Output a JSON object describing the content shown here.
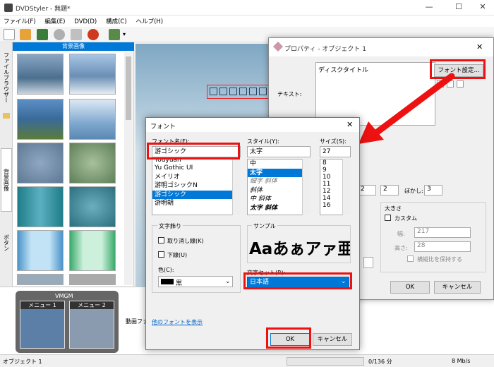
{
  "app": {
    "title": "DVDStyler - 無題*"
  },
  "menu": [
    "ファイル(F)",
    "編集(E)",
    "DVD(D)",
    "構成(C)",
    "ヘルプ(H)"
  ],
  "sidebar": {
    "tabs": [
      "ファイルブラウザー",
      "背景画像",
      "ボタン"
    ],
    "header": "背景画像"
  },
  "bottom": {
    "vmgm_label": "VMGM",
    "menu1": "メニュー 1",
    "menu2": "メニュー 2",
    "movie_label": "動画ファ"
  },
  "status": {
    "left": "オブジェクト 1",
    "progress": "0/136 分",
    "rate": "8 Mb/s"
  },
  "prop_dialog": {
    "title": "プロパティ - オブジェクト 1",
    "text_label": "テキスト:",
    "text_value": "ディスクタイトル",
    "font_button": "フォント設定...",
    "spin1": "2",
    "spin2": "2",
    "blur_label": "ぼかし:",
    "blur_value": "3",
    "size_group": "大きさ",
    "custom_label": "カスタム",
    "width_label": "幅:",
    "width_value": "217",
    "height_label": "高さ:",
    "height_value": "28",
    "keep_ratio": "横縦比を保持する",
    "ok": "OK",
    "cancel": "キャンセル"
  },
  "font_dialog": {
    "title": "フォント",
    "name_label": "フォント名(F):",
    "name_value": "游ゴシック",
    "fonts": [
      "Yu Gothic UI",
      "メイリオ",
      "游明ゴシックN",
      "游ゴシック",
      "游明朝"
    ],
    "fonts_top_partial": "Youyuan",
    "style_label": "スタイル(Y):",
    "style_value": "太字",
    "styles": [
      "中",
      "太字",
      "細字 斜体",
      "斜体",
      "中 斜体",
      "太字 斜体"
    ],
    "size_label": "サイズ(S):",
    "size_value": "27",
    "sizes": [
      "8",
      "9",
      "10",
      "11",
      "12",
      "14",
      "16"
    ],
    "effects_label": "文字飾り",
    "strike_label": "取り消し線(K)",
    "underline_label": "下線(U)",
    "color_label": "色(C):",
    "color_value": "黒",
    "sample_label": "サンプル",
    "sample_text": "Aaあぁアァ亜",
    "charset_label": "文字セット(R):",
    "charset_value": "日本語",
    "more_fonts": "他のフォントを表示",
    "ok": "OK",
    "cancel": "キャンセル"
  },
  "colors": {
    "accent": "#0078d7",
    "highlight": "#e11111"
  }
}
